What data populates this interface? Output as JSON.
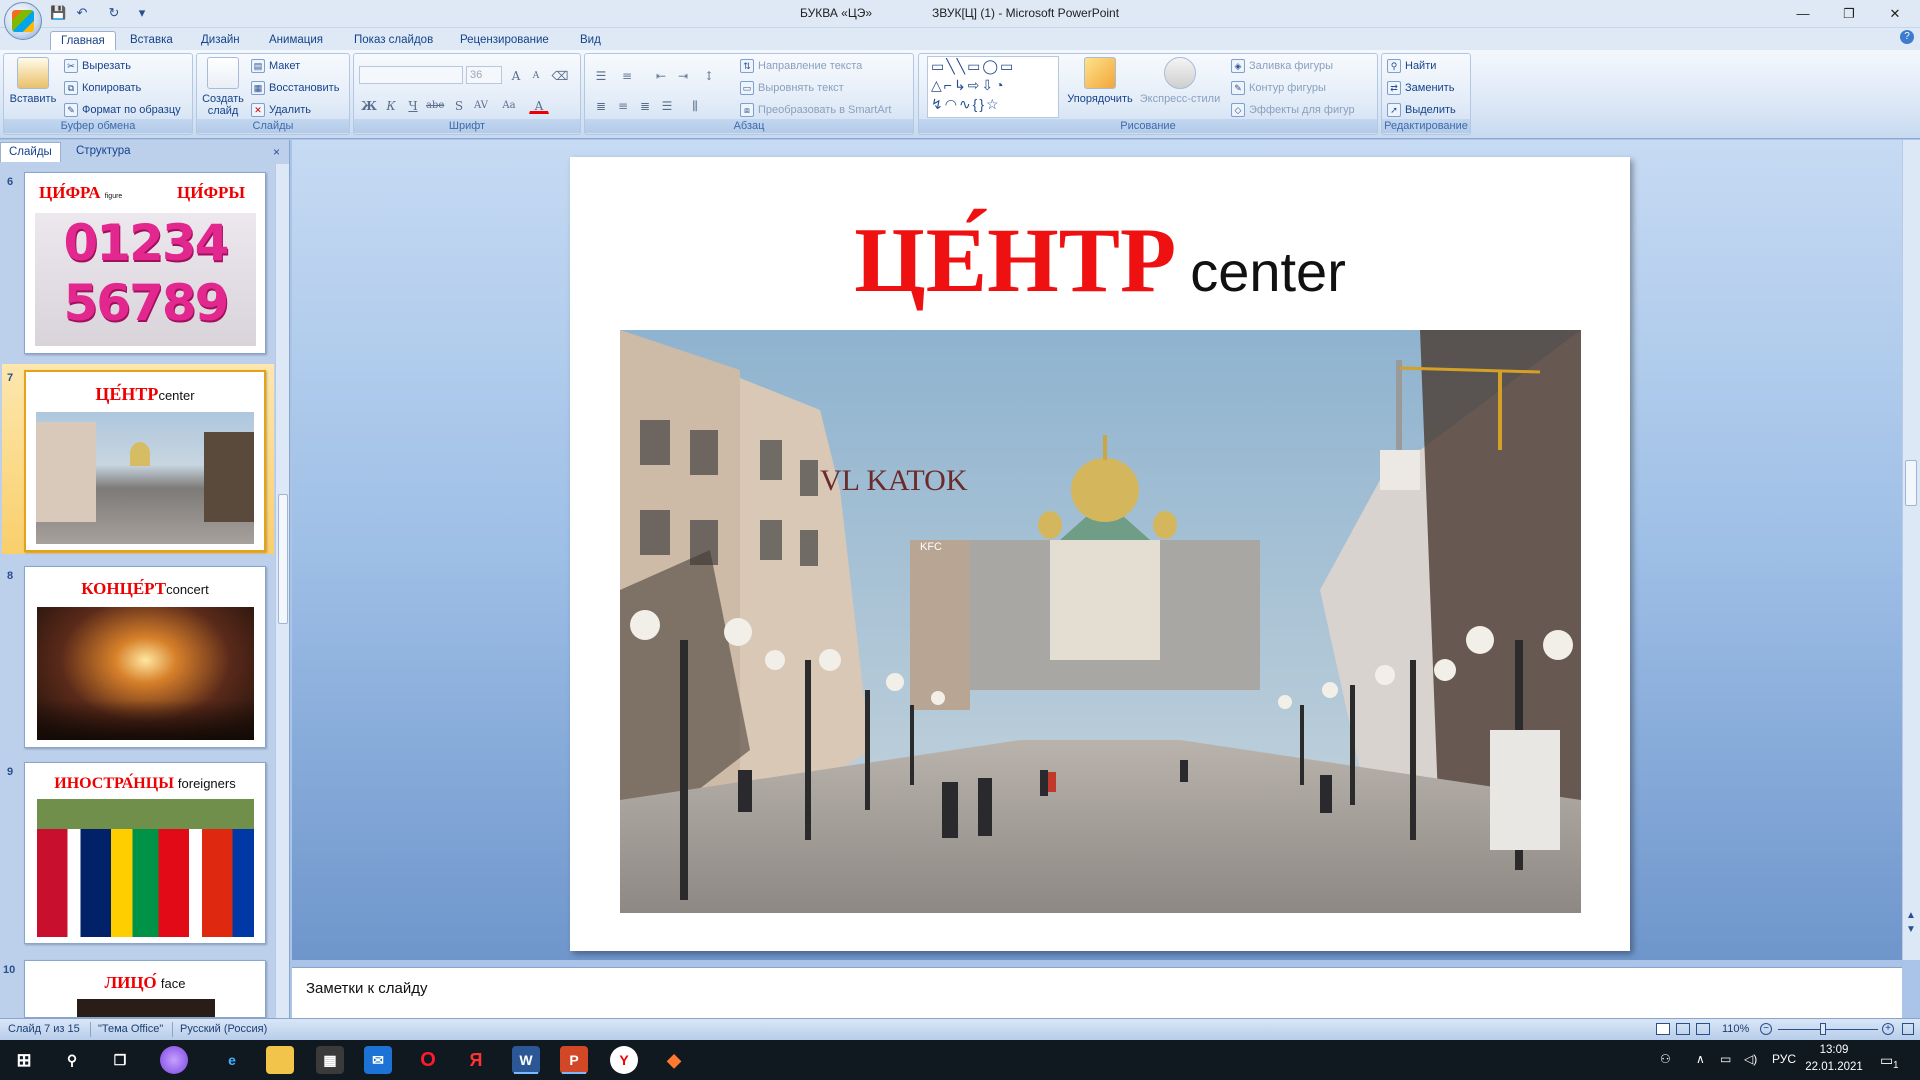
{
  "window": {
    "doc_title_part1": "БУКВА «ЦЭ»",
    "doc_title_part2": "ЗВУК[Ц] (1) - Microsoft PowerPoint",
    "minimize": "—",
    "restore": "❐",
    "close": "✕"
  },
  "qat": {
    "save": "💾",
    "undo": "↶",
    "redo": "↻",
    "more": "▾"
  },
  "ribbon_tabs": [
    "Главная",
    "Вставка",
    "Дизайн",
    "Анимация",
    "Показ слайдов",
    "Рецензирование",
    "Вид"
  ],
  "ribbon": {
    "clipboard": {
      "label": "Буфер обмена",
      "paste": "Вставить",
      "cut": "Вырезать",
      "copy": "Копировать",
      "format_painter": "Формат по образцу"
    },
    "slides": {
      "label": "Слайды",
      "new_slide": "Создать слайд",
      "layout": "Макет",
      "reset": "Восстановить",
      "delete": "Удалить"
    },
    "font": {
      "label": "Шрифт",
      "font_size": "36",
      "bold": "Ж",
      "italic": "К",
      "underline": "Ч",
      "strike": "abe",
      "shadow": "S",
      "spacing": "AV",
      "case": "Aa",
      "color": "A",
      "grow": "A",
      "shrink": "A"
    },
    "paragraph": {
      "label": "Абзац",
      "text_direction": "Направление текста",
      "align_text": "Выровнять текст",
      "smartart": "Преобразовать в SmartArt"
    },
    "drawing": {
      "label": "Рисование",
      "arrange": "Упорядочить",
      "quick_styles": "Экспресс-стили",
      "shape_fill": "Заливка фигуры",
      "shape_outline": "Контур фигуры",
      "shape_effects": "Эффекты для фигур"
    },
    "editing": {
      "label": "Редактирование",
      "find": "Найти",
      "replace": "Заменить",
      "select": "Выделить"
    }
  },
  "panel": {
    "tab_slides": "Слайды",
    "tab_outline": "Структура",
    "close": "×",
    "thumbs": [
      {
        "num": "6",
        "word": "ЦИ́ФРА",
        "en": "figure",
        "word2": "ЦИ́ФРЫ"
      },
      {
        "num": "7",
        "word": "ЦЕ́НТР",
        "en": "center"
      },
      {
        "num": "8",
        "word": "КОНЦЕ́РТ",
        "en": "concert"
      },
      {
        "num": "9",
        "word": "ИНОСТРА́НЦЫ",
        "en": "foreigners"
      },
      {
        "num": "10",
        "word": "ЛИЦО́",
        "en": "face"
      }
    ]
  },
  "slide": {
    "title_ru": "ЦЕ́НТР",
    "title_en": "center",
    "photo_sign": "VL KATOK",
    "photo_shop": "KFC"
  },
  "notes": {
    "placeholder": "Заметки к слайду"
  },
  "status": {
    "slide_counter": "Слайд 7 из 15",
    "theme": "\"Тема Office\"",
    "language": "Русский (Россия)",
    "zoom": "110%"
  },
  "taskbar": {
    "lang": "РУС",
    "time": "13:09",
    "date": "22.01.2021",
    "notif_count": "1"
  },
  "colors": {
    "title_red": "#ef1111",
    "ribbon_blue": "#15428b",
    "selected_thumb": "#f9cf6b"
  }
}
